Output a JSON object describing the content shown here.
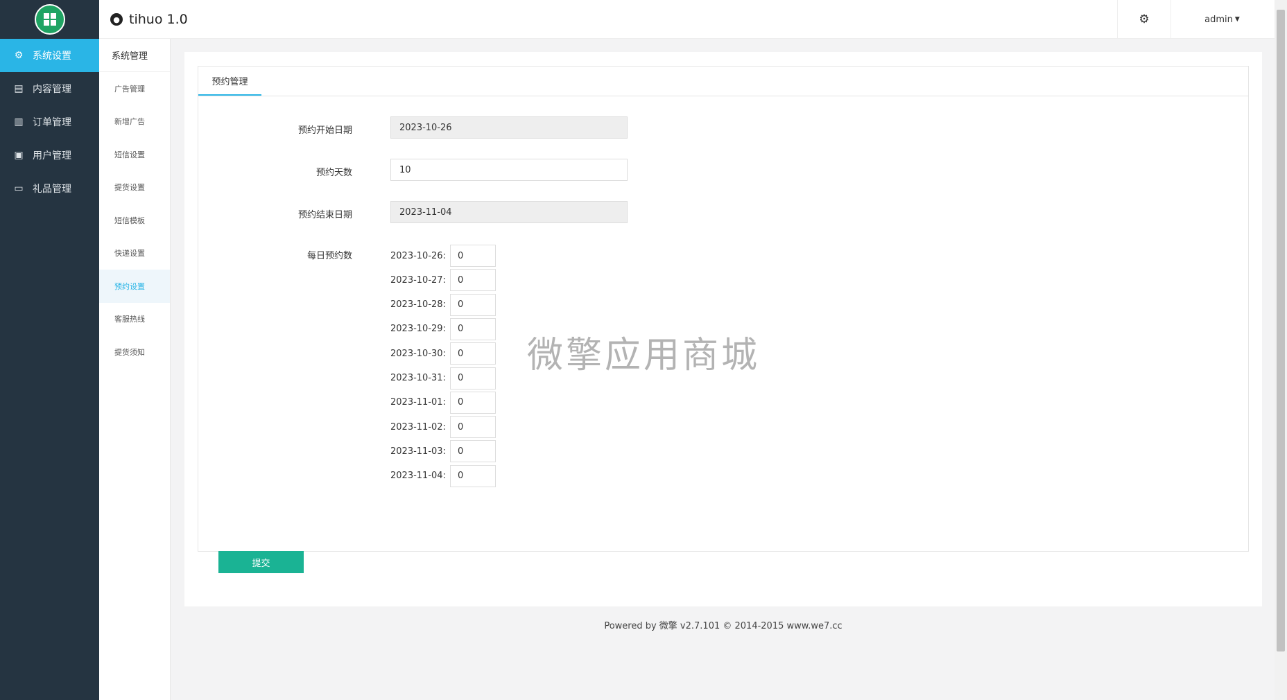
{
  "app": {
    "title": "tihuo 1.0",
    "logo_icon": "grid-logo-icon",
    "brand_icon": "app-brand-icon"
  },
  "header": {
    "settings_icon": "gear-icon",
    "user": "admin"
  },
  "sidebar": {
    "items": [
      {
        "label": "系统设置",
        "icon": "gear-icon",
        "active": true
      },
      {
        "label": "内容管理",
        "icon": "folder-icon",
        "active": false
      },
      {
        "label": "订单管理",
        "icon": "document-icon",
        "active": false
      },
      {
        "label": "用户管理",
        "icon": "card-icon",
        "active": false
      },
      {
        "label": "礼品管理",
        "icon": "monitor-icon",
        "active": false
      }
    ]
  },
  "submenu": {
    "title": "系统管理",
    "items": [
      {
        "label": "广告管理",
        "active": false
      },
      {
        "label": "新增广告",
        "active": false
      },
      {
        "label": "短信设置",
        "active": false
      },
      {
        "label": "提货设置",
        "active": false
      },
      {
        "label": "短信模板",
        "active": false
      },
      {
        "label": "快递设置",
        "active": false
      },
      {
        "label": "预约设置",
        "active": true
      },
      {
        "label": "客服热线",
        "active": false
      },
      {
        "label": "提货须知",
        "active": false
      }
    ]
  },
  "tab": {
    "label": "预约管理"
  },
  "form": {
    "start_date": {
      "label": "预约开始日期",
      "value": "2023-10-26"
    },
    "days": {
      "label": "预约天数",
      "value": "10"
    },
    "end_date": {
      "label": "预约结束日期",
      "value": "2023-11-04"
    },
    "daily": {
      "label": "每日预约数",
      "rows": [
        {
          "date": "2023-10-26:",
          "value": "0"
        },
        {
          "date": "2023-10-27:",
          "value": "0"
        },
        {
          "date": "2023-10-28:",
          "value": "0"
        },
        {
          "date": "2023-10-29:",
          "value": "0"
        },
        {
          "date": "2023-10-30:",
          "value": "0"
        },
        {
          "date": "2023-10-31:",
          "value": "0"
        },
        {
          "date": "2023-11-01:",
          "value": "0"
        },
        {
          "date": "2023-11-02:",
          "value": "0"
        },
        {
          "date": "2023-11-03:",
          "value": "0"
        },
        {
          "date": "2023-11-04:",
          "value": "0"
        }
      ]
    },
    "submit_label": "提交"
  },
  "watermark": "微擎应用商城",
  "footer": "Powered by 微擎 v2.7.101 © 2014-2015 www.we7.cc"
}
